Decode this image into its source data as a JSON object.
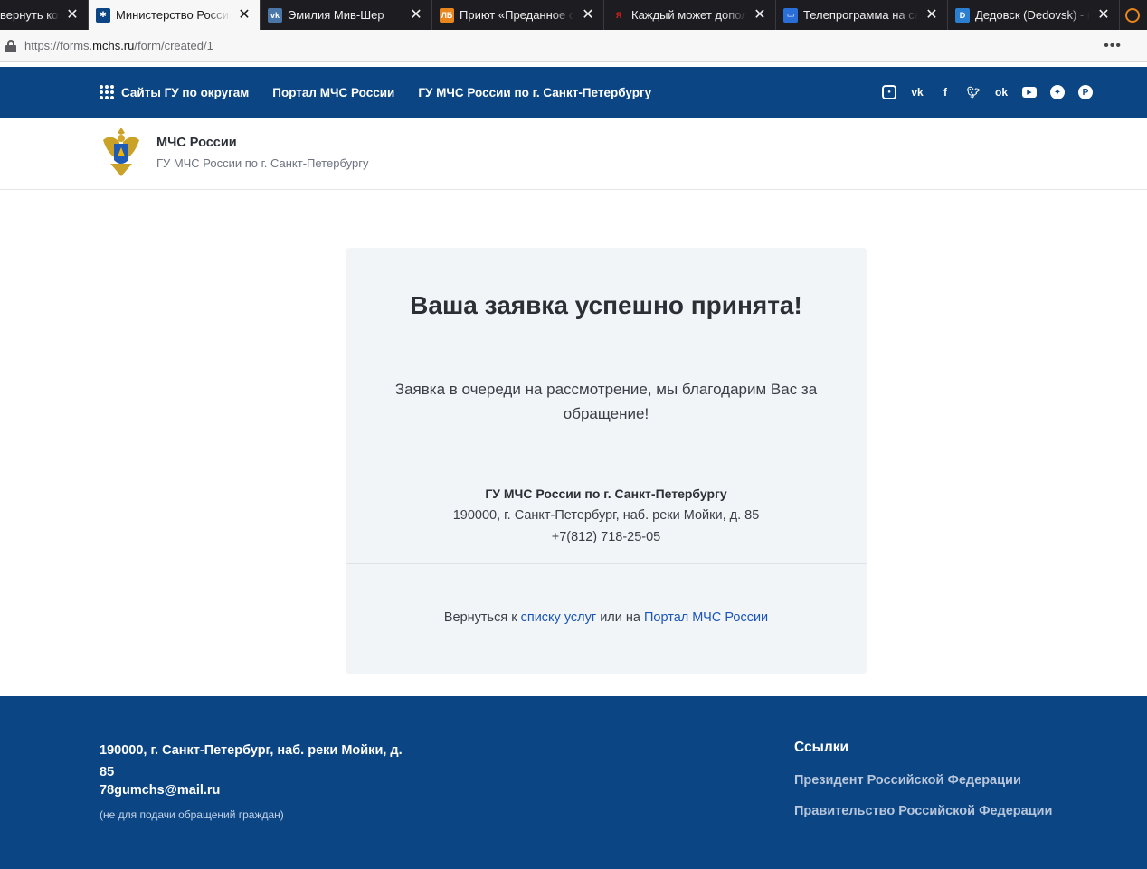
{
  "browser": {
    "tabs": [
      {
        "label": "вернуть кота",
        "favicon": "page-icon",
        "favicon_color": "#1c1c21",
        "active": false
      },
      {
        "label": "Министерство Российской",
        "favicon": "mchs-icon",
        "favicon_color": "#0b4583",
        "active": true
      },
      {
        "label": "Эмилия Мив-Шер",
        "favicon": "vk-icon",
        "favicon_color": "#4a76a8",
        "active": false
      },
      {
        "label": "Приют «Преданное сердце»",
        "favicon": "lb-icon",
        "favicon_color": "#e8851b",
        "active": false
      },
      {
        "label": "Каждый может дополнить",
        "favicon": "yandex-icon",
        "favicon_color": "#e0201b",
        "active": false
      },
      {
        "label": "Телепрограмма на сегодня",
        "favicon": "tv-icon",
        "favicon_color": "#2a6fd8",
        "active": false
      },
      {
        "label": "Дедовск (Dedovsk) - пр",
        "favicon": "dedovsk-icon",
        "favicon_color": "#2a7fd0",
        "active": false
      }
    ],
    "url": {
      "prefix": "https://forms.",
      "host": "mchs.ru",
      "path": "/form/created/1"
    },
    "menu_label": "•••"
  },
  "topnav": {
    "sites_label": "Сайты ГУ по округам",
    "portal_label": "Портал МЧС России",
    "gu_label": "ГУ МЧС России по г. Санкт-Петербургу",
    "social": [
      "instagram-icon",
      "vk-icon",
      "facebook-icon",
      "twitter-icon",
      "odnoklassniki-icon",
      "youtube-icon",
      "zen-icon",
      "pinterest-icon"
    ]
  },
  "header": {
    "title": "МЧС России",
    "subtitle": "ГУ МЧС России по г. Санкт-Петербургу"
  },
  "card": {
    "title": "Ваша заявка успешно принята!",
    "message": "Заявка в очереди на рассмотрение, мы благодарим Вас за обращение!",
    "org_name": "ГУ МЧС России по г. Санкт-Петербургу",
    "org_address": "190000, г. Санкт-Петербург, наб. реки Мойки, д. 85",
    "org_phone": "+7(812) 718-25-05",
    "return_prefix": "Вернуться к ",
    "return_link1": "списку услуг",
    "return_middle": " или на ",
    "return_link2": "Портал МЧС России"
  },
  "footer": {
    "address": "190000, г. Санкт-Петербург, наб. реки Мойки, д. 85",
    "email": "78gumchs@mail.ru",
    "email_note": "(не для подачи обращений граждан)",
    "links_title": "Ссылки",
    "link1": "Президент Российской Федерации",
    "link2": "Правительство Российской Федерации"
  },
  "colors": {
    "brand_blue": "#0b4583",
    "link_blue": "#1a56b8",
    "card_bg": "#f2f5f8"
  }
}
